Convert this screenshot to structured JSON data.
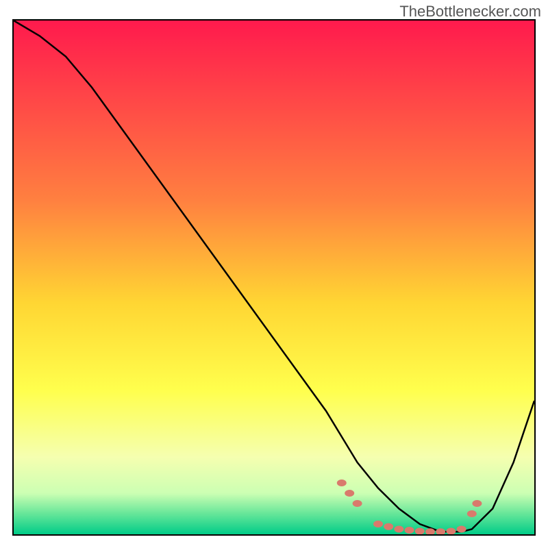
{
  "watermark": "TheBottlenecker.com",
  "chart_data": {
    "type": "line",
    "title": "",
    "xlabel": "",
    "ylabel": "",
    "xlim": [
      0,
      100
    ],
    "ylim": [
      0,
      100
    ],
    "gradient_stops": [
      {
        "offset": 0,
        "color": "#ff1a4d"
      },
      {
        "offset": 35,
        "color": "#ff8040"
      },
      {
        "offset": 55,
        "color": "#ffd633"
      },
      {
        "offset": 72,
        "color": "#ffff4d"
      },
      {
        "offset": 85,
        "color": "#f5ffb0"
      },
      {
        "offset": 92,
        "color": "#ccffb3"
      },
      {
        "offset": 96,
        "color": "#66e699"
      },
      {
        "offset": 100,
        "color": "#00cc88"
      }
    ],
    "series": [
      {
        "name": "bottleneck-curve",
        "x": [
          0,
          5,
          10,
          15,
          20,
          25,
          30,
          35,
          40,
          45,
          50,
          55,
          60,
          63,
          66,
          70,
          74,
          78,
          82,
          86,
          88,
          92,
          96,
          100
        ],
        "y": [
          100,
          97,
          93,
          87,
          80,
          73,
          66,
          59,
          52,
          45,
          38,
          31,
          24,
          19,
          14,
          9,
          5,
          2,
          0.5,
          0.5,
          1,
          5,
          14,
          26
        ]
      }
    ],
    "markers": {
      "name": "highlight-dots",
      "color": "#d97a6c",
      "points": [
        {
          "x": 63,
          "y": 10
        },
        {
          "x": 64.5,
          "y": 8
        },
        {
          "x": 66,
          "y": 6
        },
        {
          "x": 70,
          "y": 2
        },
        {
          "x": 72,
          "y": 1.5
        },
        {
          "x": 74,
          "y": 1
        },
        {
          "x": 76,
          "y": 0.8
        },
        {
          "x": 78,
          "y": 0.6
        },
        {
          "x": 80,
          "y": 0.5
        },
        {
          "x": 82,
          "y": 0.5
        },
        {
          "x": 84,
          "y": 0.6
        },
        {
          "x": 86,
          "y": 1
        },
        {
          "x": 88,
          "y": 4
        },
        {
          "x": 89,
          "y": 6
        }
      ]
    }
  }
}
